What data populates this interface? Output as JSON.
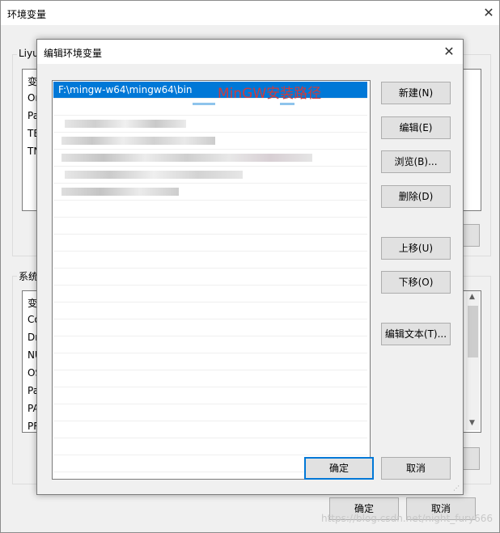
{
  "background_window": {
    "title": "环境变量",
    "user_group_label": "Liyu",
    "user_list_header": "变",
    "user_rows": [
      "Or",
      "Pa",
      "TE",
      "TN"
    ],
    "system_group_label": "系统",
    "system_list_header": "变",
    "system_rows": [
      "Co",
      "Dr",
      "NU",
      "OS",
      "Pa",
      "PA",
      "PR"
    ],
    "ok_label": "确定",
    "cancel_label": "取消"
  },
  "dialog": {
    "title": "编辑环境变量",
    "paths": [
      {
        "text": "F:\\mingw-w64\\mingw64\\bin",
        "selected": true
      }
    ],
    "annotation": "MinGW安装路径",
    "buttons": {
      "new": "新建(N)",
      "edit": "编辑(E)",
      "browse": "浏览(B)...",
      "delete": "删除(D)",
      "move_up": "上移(U)",
      "move_down": "下移(O)",
      "edit_text": "编辑文本(T)..."
    },
    "ok_label": "确定",
    "cancel_label": "取消"
  },
  "watermark": "https://blog.csdn.net/night_fury666",
  "colors": {
    "selection": "#0078d7",
    "annotation": "#d23b3b"
  }
}
